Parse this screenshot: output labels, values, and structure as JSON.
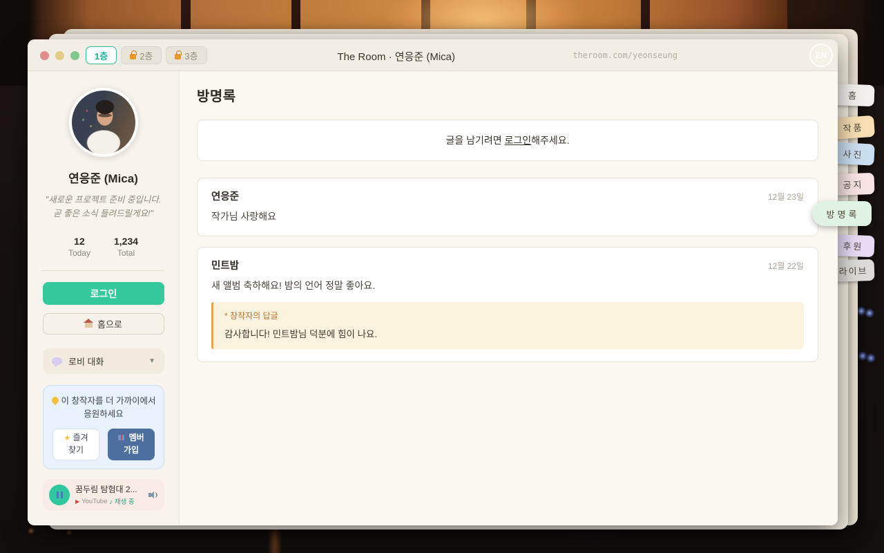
{
  "window": {
    "title": "The Room · 연응준 (Mica)",
    "url": "theroom.com/yeonseung",
    "lang_button": "EN",
    "floor_tabs": [
      {
        "label": "1층",
        "locked": false,
        "active": true
      },
      {
        "label": "2층",
        "locked": true,
        "active": false
      },
      {
        "label": "3층",
        "locked": true,
        "active": false
      }
    ]
  },
  "sidebar": {
    "profile": {
      "name": "연응준 (Mica)",
      "quote_line1": "\"새로운 프로젝트 준비 중입니다.",
      "quote_line2": "곧 좋은 소식 들려드릴게요!\""
    },
    "stats": [
      {
        "value": "12",
        "label": "Today"
      },
      {
        "value": "1,234",
        "label": "Total"
      }
    ],
    "login_button": "로그인",
    "home_button": "홈으로",
    "lobby_chat": "로비 대화",
    "support": {
      "message_line1": "이 창작자를 더 가까이에서",
      "message_line2": "응원하세요",
      "favorite_line1": "즐겨",
      "favorite_line2": "찾기",
      "member_line1": "멤버",
      "member_line2": "가입"
    },
    "player": {
      "track": "꿈두림 탐험대 2...",
      "play_icon": "▶",
      "source": "YouTube",
      "status": "♪ 재생 중"
    }
  },
  "main": {
    "heading": "방명록",
    "login_prompt_prefix": "글을 남기려면 ",
    "login_link": "로그인",
    "login_prompt_suffix": "해주세요.",
    "entries": [
      {
        "author": "연응준",
        "date": "12월 23일",
        "text": "작가님 사랑해요"
      },
      {
        "author": "민트밤",
        "date": "12월 22일",
        "text": "새 앨범 축하해요! 밤의 언어 정말 좋아요.",
        "reply_label": "* 창작자의 답글",
        "reply_text": "감사합니다! 민트밤님 덕분에 힘이 나요."
      }
    ]
  },
  "side_tabs": [
    {
      "label": "홈",
      "color": "#f2f0ed",
      "active": false
    },
    {
      "label": "작품",
      "color": "#f8dfb4",
      "active": false
    },
    {
      "label": "사진",
      "color": "#cbdff2",
      "active": false
    },
    {
      "label": "공지",
      "color": "#f8e4e5",
      "active": false
    },
    {
      "label": "방명록",
      "color": "#e0f2e4",
      "active": true
    },
    {
      "label": "후원",
      "color": "#e8dbf6",
      "active": false
    },
    {
      "label": "라이브",
      "color": "#dcdbd8",
      "active": false
    }
  ],
  "colors": {
    "accent_teal": "#2bbfa0",
    "login_green": "#35c99e",
    "member_blue": "#4d6f9f",
    "reply_orange": "#e5a53f",
    "lock_orange": "#e8962e"
  }
}
